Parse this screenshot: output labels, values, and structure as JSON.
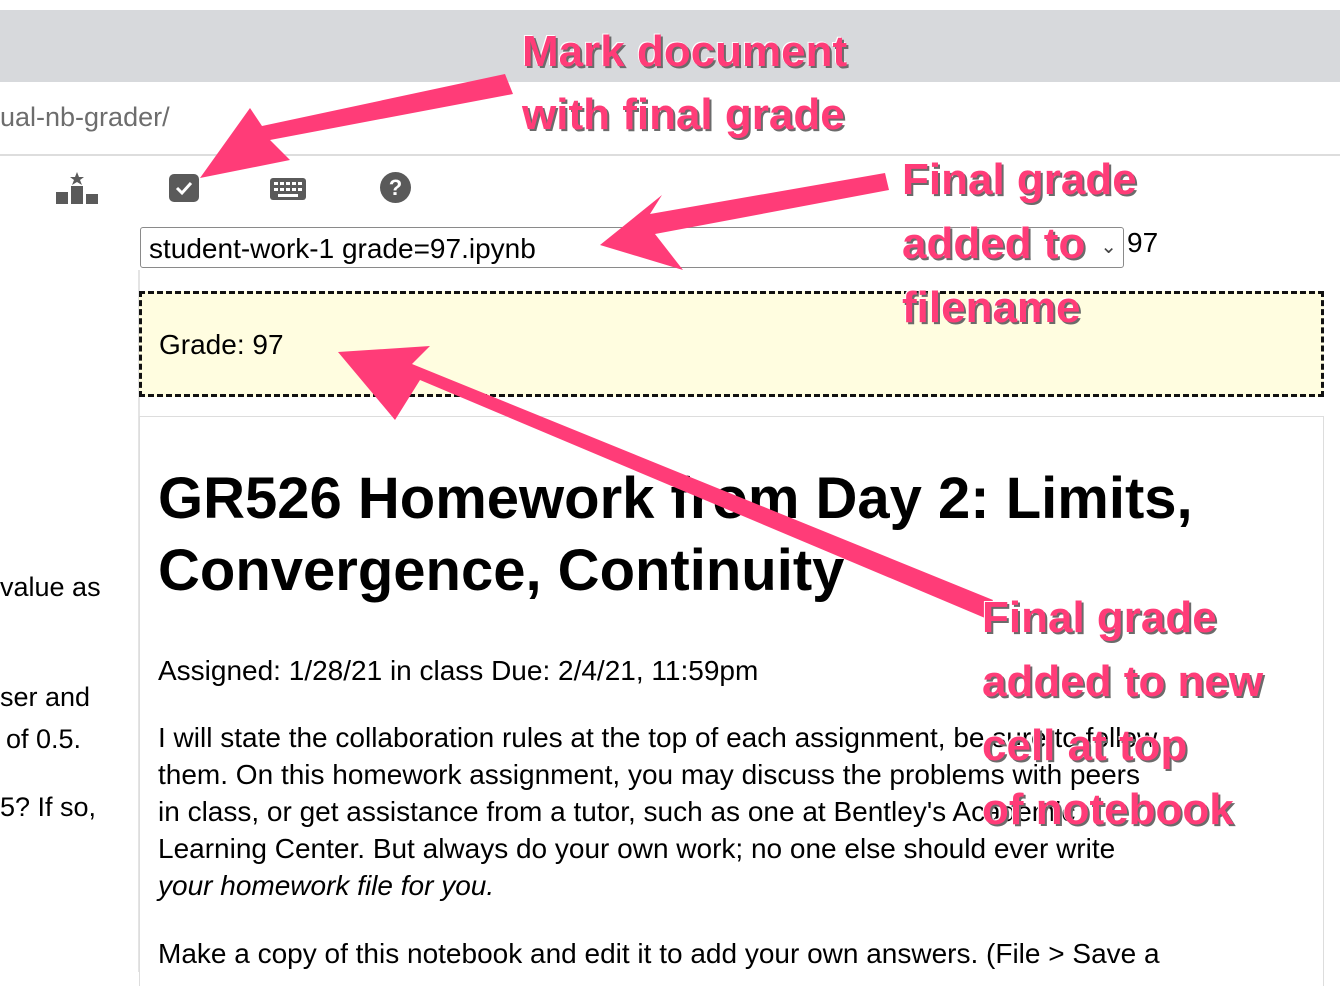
{
  "browser": {
    "url_fragment": "ual-nb-grader/"
  },
  "toolbar": {
    "icons": [
      "leaderboard-icon",
      "checkbox-icon",
      "keyboard-icon",
      "help-icon"
    ],
    "help_glyph": "?"
  },
  "file_select": {
    "selected": "student-work-1 grade=97.ipynb",
    "chevron": "⌄"
  },
  "grade_value": "97",
  "left_pane": {
    "lines": [
      "value as",
      "ser and",
      "of 0.5.",
      "5? If so,"
    ]
  },
  "grade_cell": {
    "text": "Grade: 97"
  },
  "notebook": {
    "title": "GR526 Homework from Day 2: Limits, Convergence, Continuity",
    "assigned": "Assigned: 1/28/21 in class Due: 2/4/21, 11:59pm",
    "paragraph_lines": [
      "I will state the collaboration rules at the top of each assignment, be sure to follow",
      "them. On this homework assignment, you may discuss the problems with peers",
      "in class, or get assistance from a tutor, such as one at Bentley's Academic",
      "Learning Center. But always do your own work; no one else should ever write",
      "your homework file for you."
    ],
    "copy_line": "Make a copy of this notebook and edit it to add your own answers. (File > Save a"
  },
  "annotations": {
    "mark_document": [
      "Mark document",
      "with final grade"
    ],
    "filename": [
      "Final grade",
      "added to",
      "filename"
    ],
    "new_cell": [
      "Final grade",
      "added to new",
      "cell at top",
      "of notebook"
    ]
  },
  "colors": {
    "annotation": "#ff3c78",
    "grade_cell_bg": "#fffde0",
    "topbar": "#d7d9dc"
  }
}
